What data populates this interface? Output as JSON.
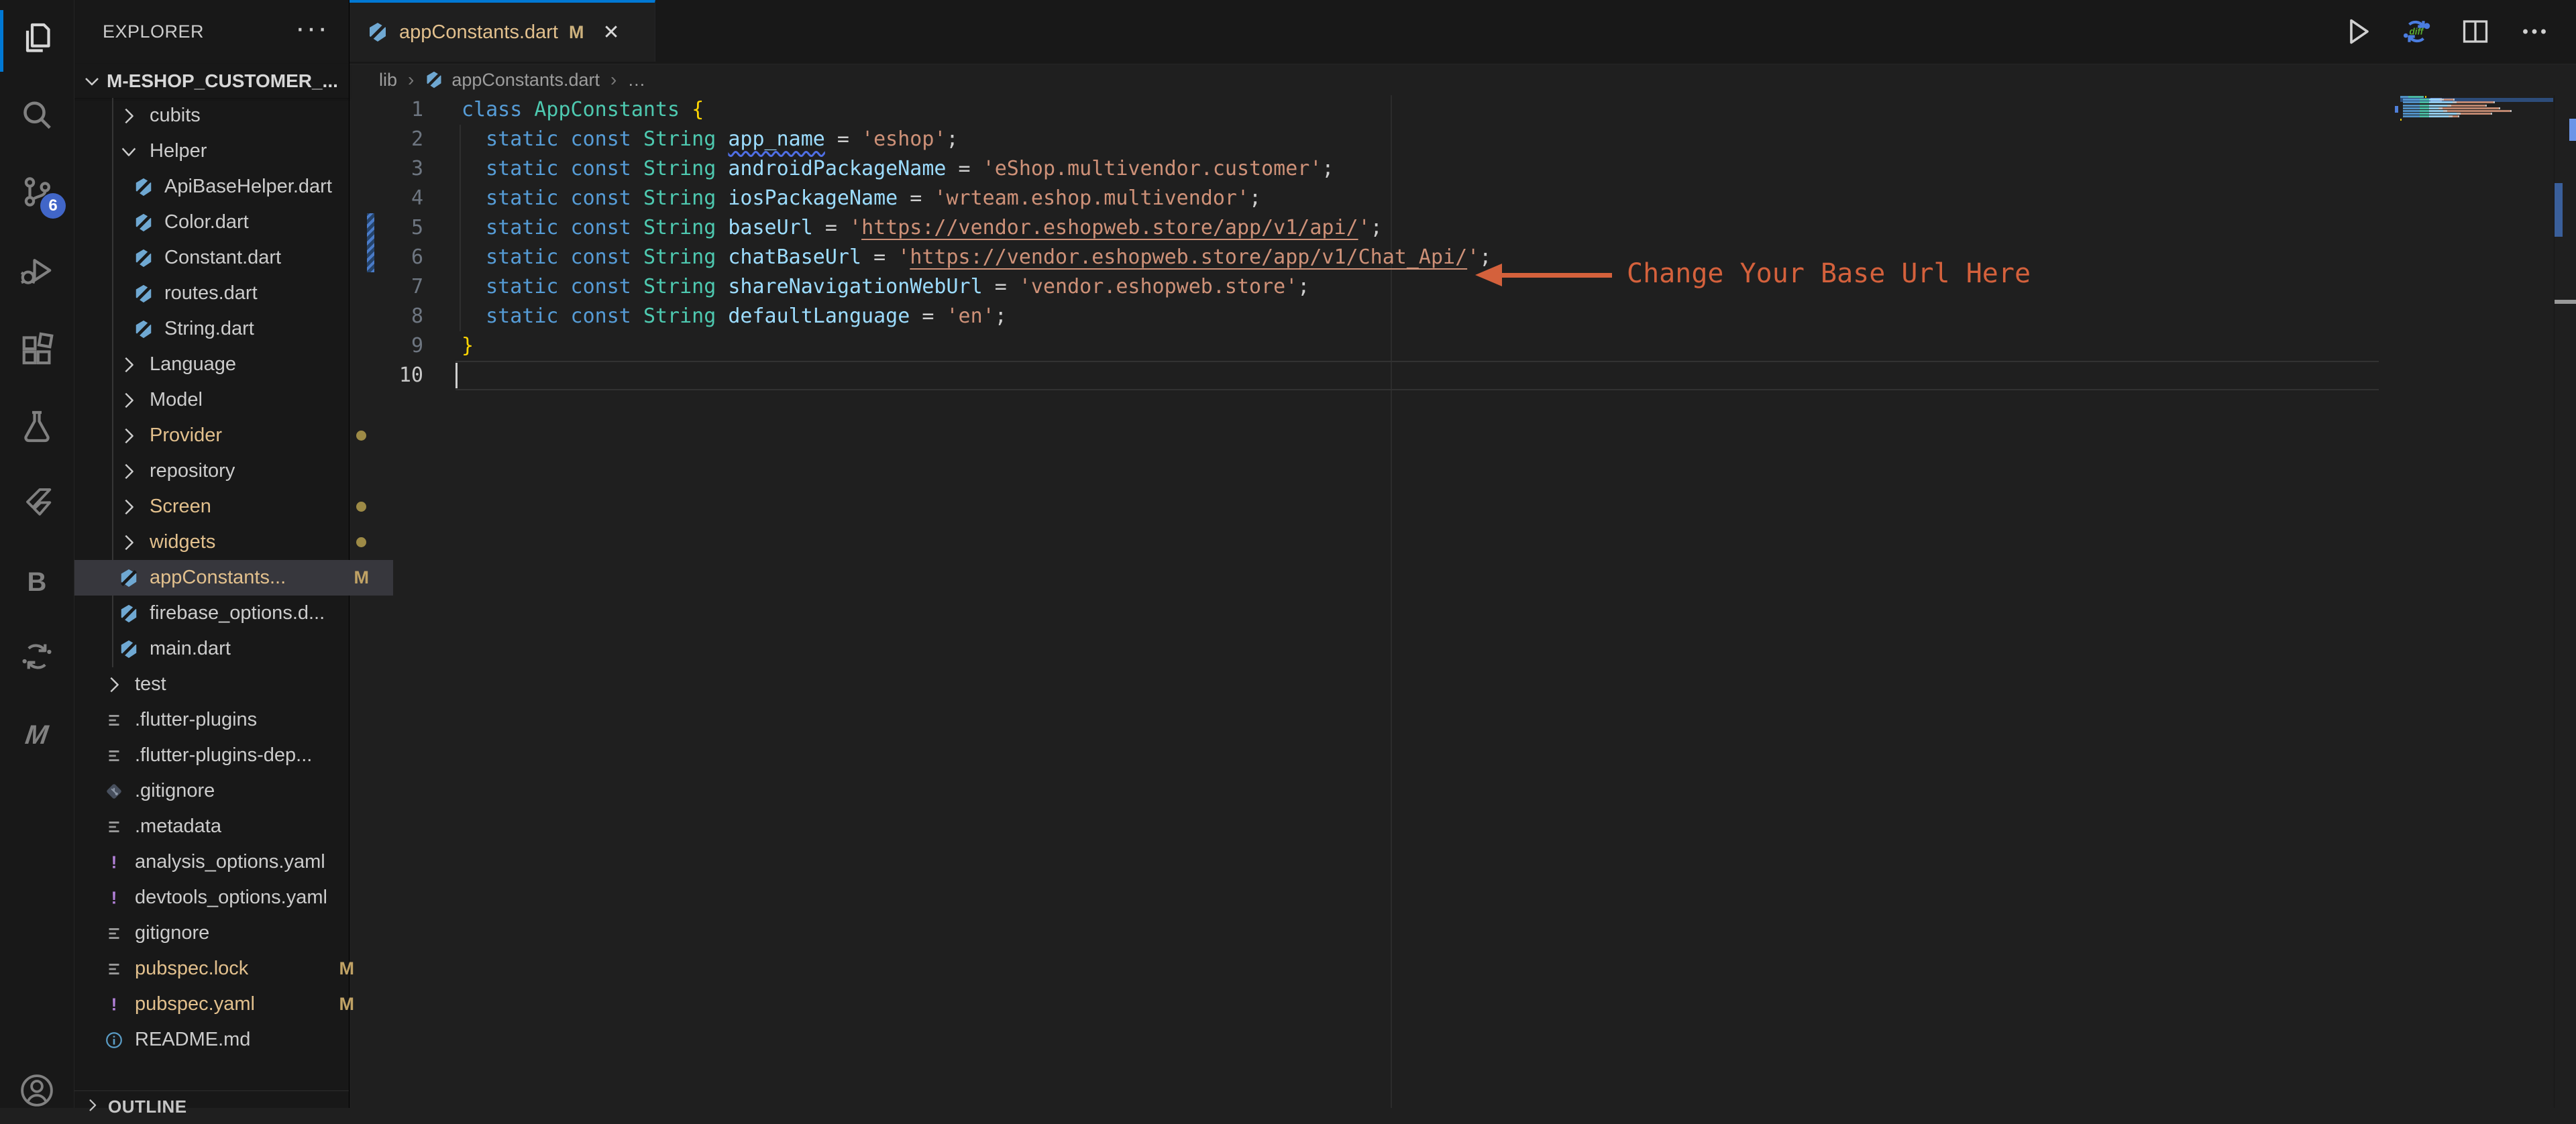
{
  "colors": {
    "accent_blue": "#0078d4",
    "badge_blue": "#4166c8",
    "modified_gold": "#e2c08d",
    "annotation_orange": "#d4613c",
    "editor_bg": "#1f1f1f",
    "panel_bg": "#181818",
    "selected_row_bg": "#37373d"
  },
  "activity_bar": {
    "scm_badge": "6",
    "bloc_label": "B",
    "m_label": "M",
    "icons": [
      "files-icon",
      "search-icon",
      "source-control-icon",
      "run-debug-icon",
      "extensions-icon",
      "testing-icon",
      "flutter-icon",
      "bloc-icon",
      "diff-tool-icon",
      "m-extension-icon",
      "account-icon"
    ]
  },
  "explorer": {
    "title": "EXPLORER",
    "menu_glyph": "···",
    "root_label": "M-ESHOP_CUSTOMER_...",
    "outline_label": "OUTLINE",
    "tree": [
      {
        "label": "cubits",
        "depth": 2,
        "type": "folder"
      },
      {
        "label": "Helper",
        "depth": 2,
        "type": "folder",
        "expanded": true
      },
      {
        "label": "ApiBaseHelper.dart",
        "depth": 3,
        "type": "dart"
      },
      {
        "label": "Color.dart",
        "depth": 3,
        "type": "dart"
      },
      {
        "label": "Constant.dart",
        "depth": 3,
        "type": "dart"
      },
      {
        "label": "routes.dart",
        "depth": 3,
        "type": "dart"
      },
      {
        "label": "String.dart",
        "depth": 3,
        "type": "dart"
      },
      {
        "label": "Language",
        "depth": 2,
        "type": "folder"
      },
      {
        "label": "Model",
        "depth": 2,
        "type": "folder"
      },
      {
        "label": "Provider",
        "depth": 2,
        "type": "folder",
        "modified": true,
        "dot": true
      },
      {
        "label": "repository",
        "depth": 2,
        "type": "folder"
      },
      {
        "label": "Screen",
        "depth": 2,
        "type": "folder",
        "modified": true,
        "dot": true
      },
      {
        "label": "widgets",
        "depth": 2,
        "type": "folder",
        "modified": true,
        "dot": true
      },
      {
        "label": "appConstants...",
        "depth": 2,
        "type": "dart",
        "modified": true,
        "badge": "M",
        "selected": true
      },
      {
        "label": "firebase_options.d...",
        "depth": 2,
        "type": "dart"
      },
      {
        "label": "main.dart",
        "depth": 2,
        "type": "dart"
      },
      {
        "label": "test",
        "depth": 1,
        "type": "folder"
      },
      {
        "label": ".flutter-plugins",
        "depth": 1,
        "type": "list"
      },
      {
        "label": ".flutter-plugins-dep...",
        "depth": 1,
        "type": "list"
      },
      {
        "label": ".gitignore",
        "depth": 1,
        "type": "git"
      },
      {
        "label": ".metadata",
        "depth": 1,
        "type": "list"
      },
      {
        "label": "analysis_options.yaml",
        "depth": 1,
        "type": "warn"
      },
      {
        "label": "devtools_options.yaml",
        "depth": 1,
        "type": "warn"
      },
      {
        "label": "gitignore",
        "depth": 1,
        "type": "list"
      },
      {
        "label": "pubspec.lock",
        "depth": 1,
        "type": "list",
        "modified": true,
        "badge": "M"
      },
      {
        "label": "pubspec.yaml",
        "depth": 1,
        "type": "warn",
        "modified": true,
        "badge": "M"
      },
      {
        "label": "README.md",
        "depth": 1,
        "type": "info"
      }
    ]
  },
  "editor_tabs": {
    "active_tab": {
      "label": "appConstants.dart",
      "modified_badge": "M"
    },
    "close_glyph": "✕"
  },
  "breadcrumb": {
    "items": [
      "lib",
      "appConstants.dart",
      "…"
    ],
    "separator": "›"
  },
  "editor": {
    "token_colors": {
      "kw": "#569cd6",
      "ty": "#4ec9b0",
      "va": "#9cdcfe",
      "vasq": "#9cdcfe",
      "op": "#cfcfcf",
      "st": "#ce9178",
      "stl": "#ce9178",
      "br": "#ffd602"
    },
    "active_line": 10,
    "modified_lines": [
      5,
      6
    ],
    "lines": [
      {
        "n": 1,
        "tokens": [
          [
            "class ",
            "kw"
          ],
          [
            "AppConstants",
            "ty"
          ],
          [
            " ",
            "op"
          ],
          [
            "{",
            "br"
          ]
        ]
      },
      {
        "n": 2,
        "tokens": [
          [
            "  ",
            "op"
          ],
          [
            "static const ",
            "kw"
          ],
          [
            "String ",
            "ty"
          ],
          [
            "app_name",
            "vasq"
          ],
          [
            " = ",
            "op"
          ],
          [
            "'eshop'",
            "st"
          ],
          [
            ";",
            "op"
          ]
        ]
      },
      {
        "n": 3,
        "tokens": [
          [
            "  ",
            "op"
          ],
          [
            "static const ",
            "kw"
          ],
          [
            "String ",
            "ty"
          ],
          [
            "androidPackageName",
            "va"
          ],
          [
            " = ",
            "op"
          ],
          [
            "'eShop.multivendor.customer'",
            "st"
          ],
          [
            ";",
            "op"
          ]
        ]
      },
      {
        "n": 4,
        "tokens": [
          [
            "  ",
            "op"
          ],
          [
            "static const ",
            "kw"
          ],
          [
            "String ",
            "ty"
          ],
          [
            "iosPackageName",
            "va"
          ],
          [
            " = ",
            "op"
          ],
          [
            "'wrteam.eshop.multivendor'",
            "st"
          ],
          [
            ";",
            "op"
          ]
        ]
      },
      {
        "n": 5,
        "tokens": [
          [
            "  ",
            "op"
          ],
          [
            "static const ",
            "kw"
          ],
          [
            "String ",
            "ty"
          ],
          [
            "baseUrl",
            "va"
          ],
          [
            " = ",
            "op"
          ],
          [
            "'",
            "st"
          ],
          [
            "https://vendor.eshopweb.store/app/v1/api/",
            "stl"
          ],
          [
            "'",
            "st"
          ],
          [
            ";",
            "op"
          ]
        ]
      },
      {
        "n": 6,
        "tokens": [
          [
            "  ",
            "op"
          ],
          [
            "static const ",
            "kw"
          ],
          [
            "String ",
            "ty"
          ],
          [
            "chatBaseUrl",
            "va"
          ],
          [
            " = ",
            "op"
          ],
          [
            "'",
            "st"
          ],
          [
            "https://vendor.eshopweb.store/app/v1/Chat_Api/",
            "stl"
          ],
          [
            "'",
            "st"
          ],
          [
            ";",
            "op"
          ]
        ]
      },
      {
        "n": 7,
        "tokens": [
          [
            "  ",
            "op"
          ],
          [
            "static const ",
            "kw"
          ],
          [
            "String ",
            "ty"
          ],
          [
            "shareNavigationWebUrl",
            "va"
          ],
          [
            " = ",
            "op"
          ],
          [
            "'vendor.eshopweb.store'",
            "st"
          ],
          [
            ";",
            "op"
          ]
        ]
      },
      {
        "n": 8,
        "tokens": [
          [
            "  ",
            "op"
          ],
          [
            "static const ",
            "kw"
          ],
          [
            "String ",
            "ty"
          ],
          [
            "defaultLanguage",
            "va"
          ],
          [
            " = ",
            "op"
          ],
          [
            "'en'",
            "st"
          ],
          [
            ";",
            "op"
          ]
        ]
      },
      {
        "n": 9,
        "tokens": [
          [
            "}",
            "br"
          ]
        ]
      },
      {
        "n": 10,
        "tokens": []
      }
    ]
  },
  "annotation": {
    "text": "Change Your Base Url Here"
  }
}
